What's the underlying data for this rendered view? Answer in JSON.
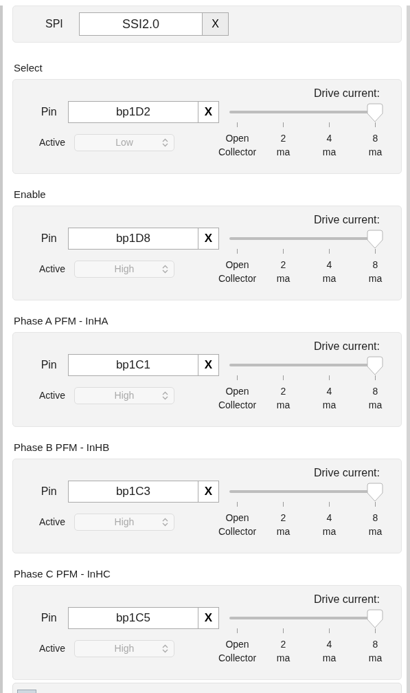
{
  "spi": {
    "label": "SPI",
    "value": "SSI2.0",
    "clear": "X"
  },
  "sections": [
    {
      "title": "Select",
      "pin_label": "Pin",
      "pin": "bp1D2",
      "clear": "X",
      "active_label": "Active",
      "active": {
        "value": "Low",
        "disabled": true
      },
      "drive": {
        "title": "Drive current:",
        "level": 1,
        "stops": [
          {
            "line1": "Open",
            "line2": "Collector"
          },
          {
            "line1": "2",
            "line2": "ma"
          },
          {
            "line1": "4",
            "line2": "ma"
          },
          {
            "line1": "8",
            "line2": "ma"
          }
        ]
      }
    },
    {
      "title": "Enable",
      "pin_label": "Pin",
      "pin": "bp1D8",
      "clear": "X",
      "active_label": "Active",
      "active": {
        "value": "High",
        "disabled": true
      },
      "drive": {
        "title": "Drive current:",
        "level": 1,
        "stops": [
          {
            "line1": "Open",
            "line2": "Collector"
          },
          {
            "line1": "2",
            "line2": "ma"
          },
          {
            "line1": "4",
            "line2": "ma"
          },
          {
            "line1": "8",
            "line2": "ma"
          }
        ]
      }
    },
    {
      "title": "Phase A PFM - InHA",
      "pin_label": "Pin",
      "pin": "bp1C1",
      "clear": "X",
      "active_label": "Active",
      "active": {
        "value": "High",
        "disabled": true
      },
      "drive": {
        "title": "Drive current:",
        "level": 1,
        "stops": [
          {
            "line1": "Open",
            "line2": "Collector"
          },
          {
            "line1": "2",
            "line2": "ma"
          },
          {
            "line1": "4",
            "line2": "ma"
          },
          {
            "line1": "8",
            "line2": "ma"
          }
        ]
      }
    },
    {
      "title": "Phase B PFM - InHB",
      "pin_label": "Pin",
      "pin": "bp1C3",
      "clear": "X",
      "active_label": "Active",
      "active": {
        "value": "High",
        "disabled": true
      },
      "drive": {
        "title": "Drive current:",
        "level": 1,
        "stops": [
          {
            "line1": "Open",
            "line2": "Collector"
          },
          {
            "line1": "2",
            "line2": "ma"
          },
          {
            "line1": "4",
            "line2": "ma"
          },
          {
            "line1": "8",
            "line2": "ma"
          }
        ]
      }
    },
    {
      "title": "Phase C PFM - InHC",
      "pin_label": "Pin",
      "pin": "bp1C5",
      "clear": "X",
      "active_label": "Active",
      "active": {
        "value": "High",
        "disabled": true
      },
      "drive": {
        "title": "Drive current:",
        "level": 1,
        "stops": [
          {
            "line1": "Open",
            "line2": "Collector"
          },
          {
            "line1": "2",
            "line2": "ma"
          },
          {
            "line1": "4",
            "line2": "ma"
          },
          {
            "line1": "8",
            "line2": "ma"
          }
        ]
      }
    }
  ]
}
